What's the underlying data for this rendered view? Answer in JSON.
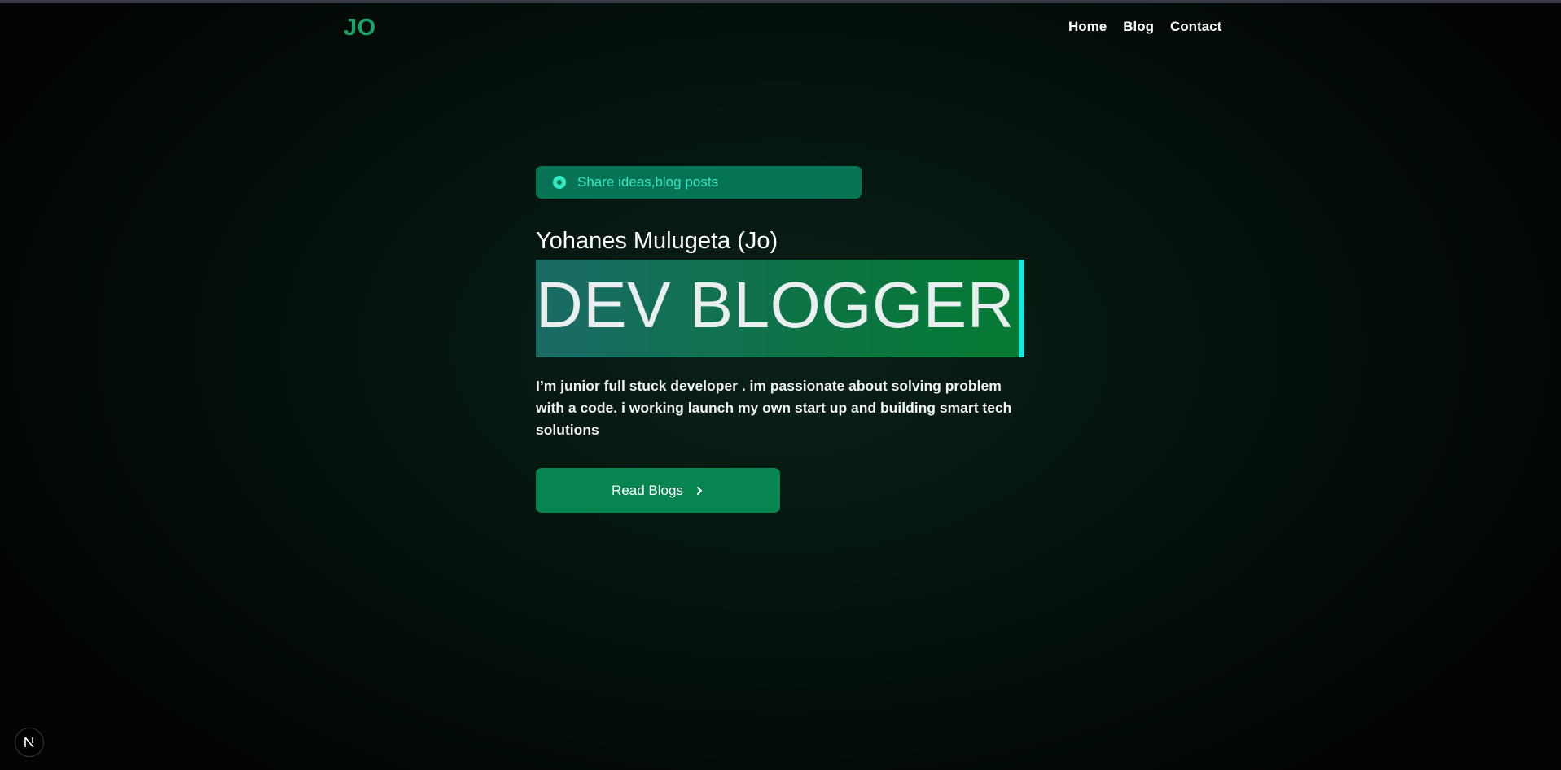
{
  "header": {
    "logo": "JO",
    "nav": [
      "Home",
      "Blog",
      "Contact"
    ]
  },
  "hero": {
    "badge_text": "Share ideas,blog posts",
    "name": "Yohanes Mulugeta (Jo)",
    "headline": "DEV BLOGGER",
    "bio": "I’m junior full stuck developer . im passionate about solving problem with a code. i working launch my own start up and building smart tech solutions",
    "cta_label": "Read Blogs",
    "cta_icon": "chevron-right-icon"
  },
  "dev_indicator": {
    "icon": "nextjs-logo-icon",
    "label": "N"
  },
  "colors": {
    "accent_green": "#14a86a",
    "badge_bg": "#077455",
    "badge_text": "#35e6c3",
    "cursor": "#19e8e0",
    "button_bg": "#068551"
  }
}
